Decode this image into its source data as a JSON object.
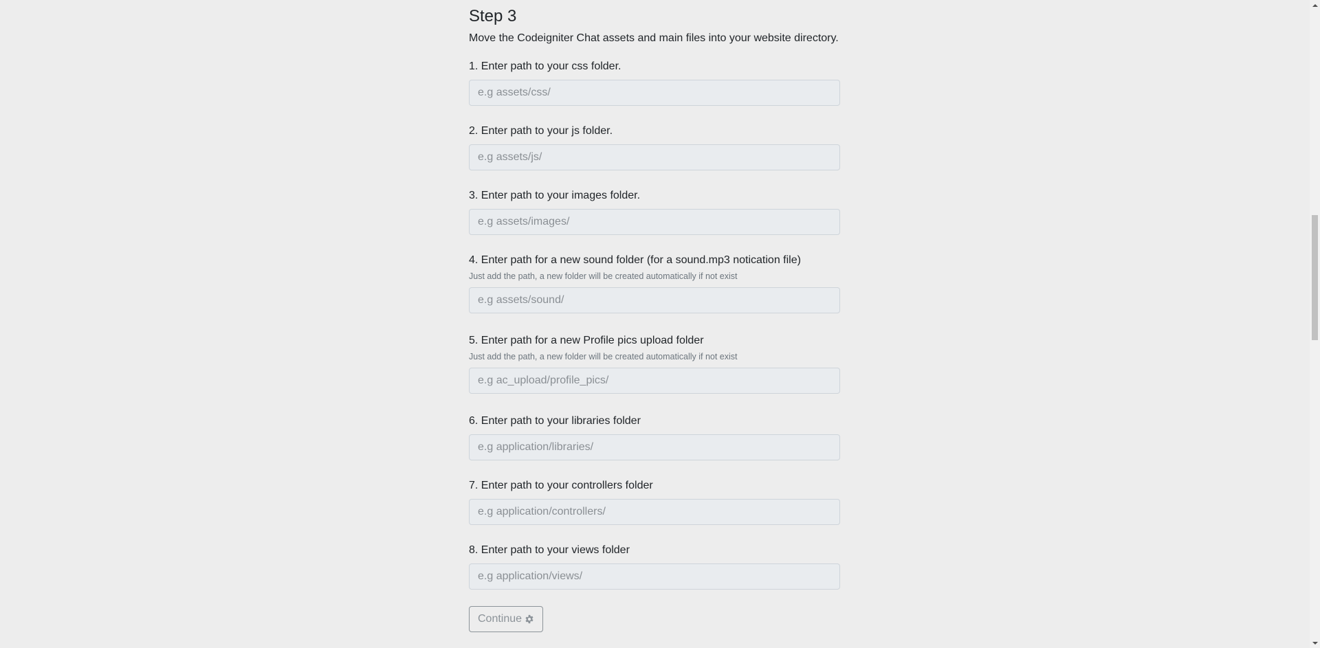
{
  "step": {
    "title": "Step 3",
    "description": "Move the Codeigniter Chat assets and main files into your website directory."
  },
  "fields": [
    {
      "label": "1. Enter path to your css folder.",
      "hint": "",
      "placeholder": "e.g assets/css/",
      "value": ""
    },
    {
      "label": "2. Enter path to your js folder.",
      "hint": "",
      "placeholder": "e.g assets/js/",
      "value": ""
    },
    {
      "label": "3. Enter path to your images folder.",
      "hint": "",
      "placeholder": "e.g assets/images/",
      "value": ""
    },
    {
      "label": "4. Enter path for a new sound folder (for a sound.mp3 notication file)",
      "hint": "Just add the path, a new folder will be created automatically if not exist",
      "placeholder": "e.g assets/sound/",
      "value": ""
    },
    {
      "label": "5. Enter path for a new Profile pics upload folder",
      "hint": "Just add the path, a new folder will be created automatically if not exist",
      "placeholder": "e.g ac_upload/profile_pics/",
      "value": ""
    },
    {
      "label": "6. Enter path to your libraries folder",
      "hint": "",
      "placeholder": "e.g application/libraries/",
      "value": ""
    },
    {
      "label": "7. Enter path to your controllers folder",
      "hint": "",
      "placeholder": "e.g application/controllers/",
      "value": ""
    },
    {
      "label": "8. Enter path to your views folder",
      "hint": "",
      "placeholder": "e.g application/views/",
      "value": ""
    }
  ],
  "continue_button": {
    "label": "Continue",
    "icon": "gear-icon",
    "disabled": true
  },
  "colors": {
    "background": "#ededed",
    "input_background": "#e9ecef",
    "input_border": "#ced4da",
    "muted_text": "#6c757d"
  }
}
